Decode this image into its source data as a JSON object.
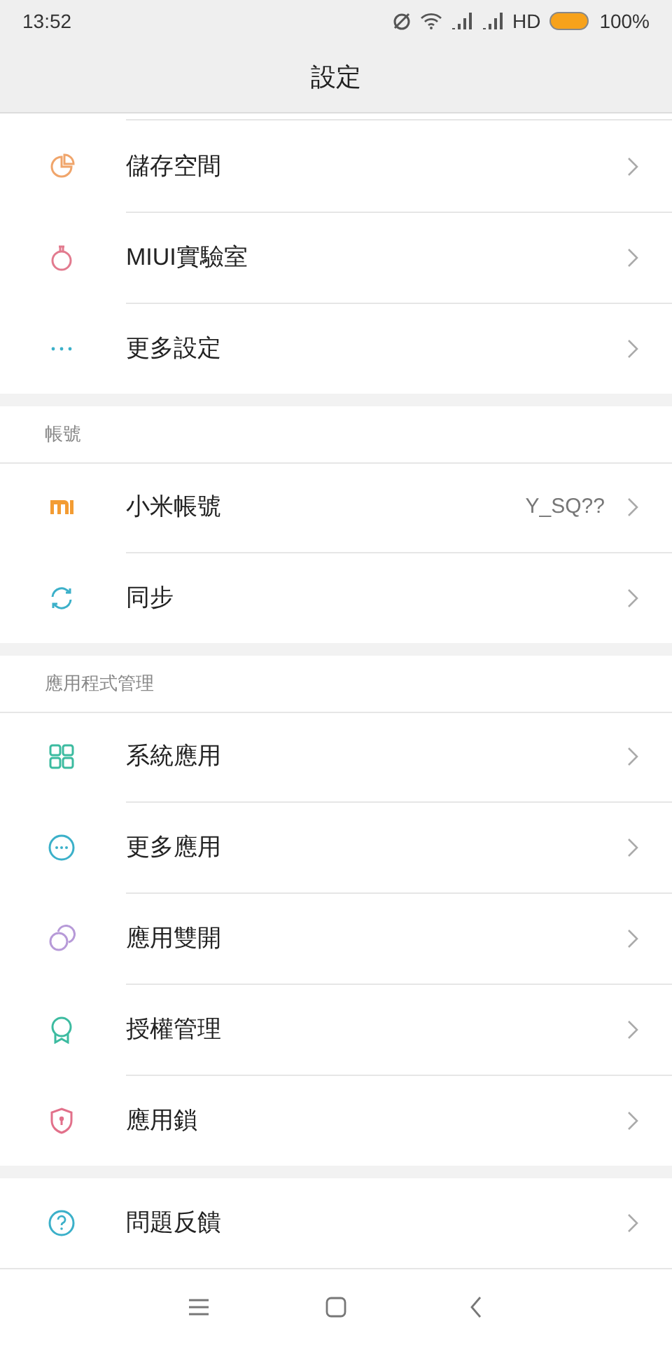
{
  "status_bar": {
    "time": "13:52",
    "network": "HD",
    "battery": "100%"
  },
  "title": "設定",
  "sections": [
    {
      "items": [
        {
          "label": "儲存空間"
        },
        {
          "label": "MIUI實驗室"
        },
        {
          "label": "更多設定"
        }
      ]
    },
    {
      "header": "帳號",
      "items": [
        {
          "label": "小米帳號",
          "value": "Y_SQ??"
        },
        {
          "label": "同步"
        }
      ]
    },
    {
      "header": "應用程式管理",
      "items": [
        {
          "label": "系統應用"
        },
        {
          "label": "更多應用"
        },
        {
          "label": "應用雙開"
        },
        {
          "label": "授權管理"
        },
        {
          "label": "應用鎖"
        }
      ]
    },
    {
      "items": [
        {
          "label": "問題反饋"
        }
      ]
    }
  ]
}
